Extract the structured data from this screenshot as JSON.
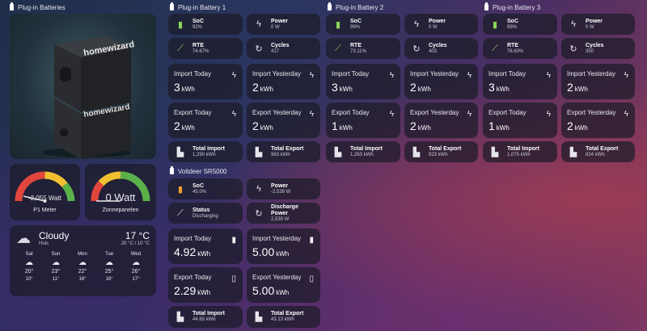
{
  "sections": {
    "plugin_batteries": "Plug-in Batteries",
    "battery1": "Plug-in Battery 1",
    "battery2": "Plug-in Battery 2",
    "battery3": "Plug-in Battery 3",
    "voltdeer": "Voltdeer SR5000"
  },
  "device_image": {
    "brand_top": "homewizard",
    "brand_bottom": "homewizard"
  },
  "gauges": {
    "p1": {
      "value": "-2,055 Watt",
      "label": "P1 Meter",
      "level": 0.75
    },
    "solar": {
      "value": "0 Watt",
      "label": "Zonnepanelen",
      "level": 0.0
    }
  },
  "weather": {
    "condition": "Cloudy",
    "location": "Huis",
    "temp": "17 °C",
    "range": "20 °C / 10 °C",
    "forecast": [
      {
        "day": "Sat",
        "high": "20°",
        "low": "10°"
      },
      {
        "day": "Sun",
        "high": "23°",
        "low": "11°"
      },
      {
        "day": "Mon",
        "high": "22°",
        "low": "16°"
      },
      {
        "day": "Tue",
        "high": "25°",
        "low": "16°"
      },
      {
        "day": "Wed",
        "high": "26°",
        "low": "17°"
      }
    ]
  },
  "batteries": [
    {
      "soc_label": "SoC",
      "soc": "92%",
      "power_label": "Power",
      "power": "0 W",
      "rte_label": "RTE",
      "rte": "74.67%",
      "cycles_label": "Cycles",
      "cycles": "417",
      "import_today_label": "Import Today",
      "import_today": "3",
      "import_yest_label": "Import Yesterday",
      "import_yest": "2",
      "export_today_label": "Export Today",
      "export_today": "2",
      "export_yest_label": "Export Yesterday",
      "export_yest": "2",
      "unit": "kWh",
      "total_import_label": "Total Import",
      "total_import": "1,290 kWh",
      "total_export_label": "Total Export",
      "total_export": "963 kWh"
    },
    {
      "soc_label": "SoC",
      "soc": "99%",
      "power_label": "Power",
      "power": "0 W",
      "rte_label": "RTE",
      "rte": "73.11%",
      "cycles_label": "Cycles",
      "cycles": "403",
      "import_today_label": "Import Today",
      "import_today": "3",
      "import_yest_label": "Import Yesterday",
      "import_yest": "2",
      "export_today_label": "Export Today",
      "export_today": "1",
      "export_yest_label": "Export Yesterday",
      "export_yest": "2",
      "unit": "kWh",
      "total_import_label": "Total Import",
      "total_import": "1,263 kWh",
      "total_export_label": "Total Export",
      "total_export": "923 kWh"
    },
    {
      "soc_label": "SoC",
      "soc": "99%",
      "power_label": "Power",
      "power": "0 W",
      "rte_label": "RTE",
      "rte": "76.63%",
      "cycles_label": "Cycles",
      "cycles": "350",
      "import_today_label": "Import Today",
      "import_today": "3",
      "import_yest_label": "Import Yesterday",
      "import_yest": "2",
      "export_today_label": "Export Today",
      "export_today": "1",
      "export_yest_label": "Export Yesterday",
      "export_yest": "2",
      "unit": "kWh",
      "total_import_label": "Total Import",
      "total_import": "1,075 kWh",
      "total_export_label": "Total Export",
      "total_export": "824 kWh"
    }
  ],
  "voltdeer": {
    "soc_label": "SoC",
    "soc": "45.0%",
    "power_label": "Power",
    "power": "-2,539 W",
    "status_label": "Status",
    "status": "Discharging",
    "discharge_label": "Discharge Power",
    "discharge": "2,539 W",
    "import_today_label": "Import Today",
    "import_today": "4.92",
    "import_yest_label": "Import Yesterday",
    "import_yest": "5.00",
    "export_today_label": "Export Today",
    "export_today": "2.29",
    "export_yest_label": "Export Yesterday",
    "export_yest": "5.00",
    "unit": "kWh",
    "total_import_label": "Total Import",
    "total_import": "44.65 kWh",
    "total_export_label": "Total Export",
    "total_export": "43.13 kWh"
  }
}
